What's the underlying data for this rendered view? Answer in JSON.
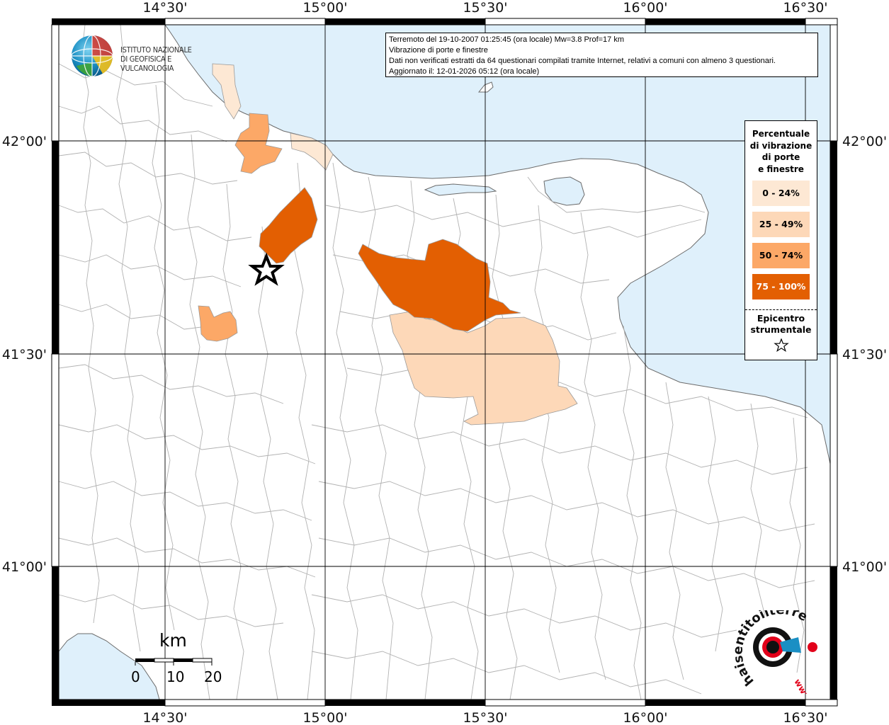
{
  "info": {
    "line1": "Terremoto del 19-10-2007 01:25:45 (ora locale) Mw=3.8 Prof=17 km",
    "line2": "Vibrazione di porte e finestre",
    "line3": "Dati non verificati estratti da 64 questionari compilati tramite Internet, relativi a comuni con almeno 3 questionari.",
    "line4": "Aggiornato il: 12-01-2026 05:12 (ora locale)"
  },
  "axes": {
    "top": [
      "14°30'",
      "15°00'",
      "15°30'",
      "16°00'",
      "16°30'"
    ],
    "bottom": [
      "14°30'",
      "15°00'",
      "15°30'",
      "16°00'",
      "16°30'"
    ],
    "left": [
      "42°00'",
      "41°30'",
      "41°00'"
    ],
    "right": [
      "42°00'",
      "41°30'",
      "41°00'"
    ]
  },
  "logos": {
    "ingv_line1": "ISTITUTO NAZIONALE",
    "ingv_line2": "DI GEOFISICA E VULCANOLOGIA",
    "hsit_text": "haisentitoilterremoto.it",
    "hsit_www": "www."
  },
  "legend": {
    "title_lines": [
      "Percentuale",
      "di vibrazione",
      "di porte",
      "e finestre"
    ],
    "classes": [
      {
        "label": "0 - 24%",
        "color": "#fde8d4"
      },
      {
        "label": "25 - 49%",
        "color": "#fdd8b8"
      },
      {
        "label": "50 - 74%",
        "color": "#fca867"
      },
      {
        "label": "75 - 100%",
        "color": "#e35f02"
      }
    ],
    "epicenter_lines": [
      "Epicentro",
      "strumentale"
    ],
    "epicenter_icon": "star-outline-icon"
  },
  "scale": {
    "unit": "km",
    "labels": [
      "0",
      "10",
      "20"
    ]
  },
  "colors": {
    "sea": "#dff0fb",
    "land": "#ffffff",
    "grid": "#000000",
    "border": "#aaaaaa"
  }
}
